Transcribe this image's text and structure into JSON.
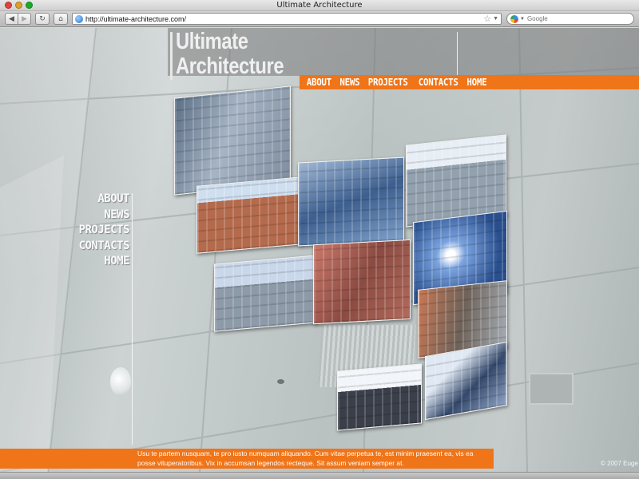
{
  "window": {
    "title": "Ultimate Architecture"
  },
  "toolbar": {
    "back_icon": "◀",
    "forward_icon": "▶",
    "reload_icon": "↻",
    "home_icon": "⌂",
    "url": "http://ultimate-architecture.com/",
    "search_placeholder": "Google"
  },
  "site": {
    "logo_line1": "Ultimate",
    "logo_line2": "Architecture",
    "top_nav": [
      "ABOUT",
      "NEWS",
      "PROJECTS",
      "CONTACTS",
      "HOME"
    ],
    "side_nav": [
      "ABOUT",
      "NEWS",
      "PROJECTS",
      "CONTACTS",
      "HOME"
    ],
    "footer_text": "Usu te partem nusquam, te pro iusto numquam aliquando. Cum vitae perpetua te, est minim praesent ea, vis ea posse vituperatoribus. Vix in accumsan legendos recteque. Sit assum veniam semper at.",
    "copyright": "© 2007 Euge",
    "accent_color": "#f07418"
  },
  "gallery": {
    "tiles": [
      "building-photo",
      "building-photo",
      "building-photo",
      "building-photo",
      "building-photo",
      "building-photo",
      "building-photo",
      "building-photo",
      "building-photo",
      "building-photo"
    ]
  }
}
